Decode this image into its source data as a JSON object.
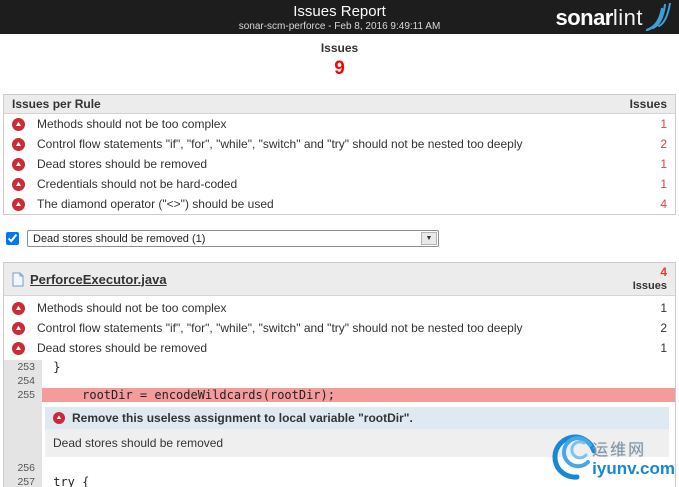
{
  "header": {
    "title": "Issues Report",
    "subtitle": "sonar-scm-perforce - Feb 8, 2016 9:49:11 AM",
    "logo_bold": "sonar",
    "logo_light": "lint"
  },
  "summary": {
    "label": "Issues",
    "count": "9"
  },
  "colors": {
    "banner_bg": "#1d1d1d",
    "accent_red": "#e4403c",
    "icon_red": "#cc2a36",
    "highlight_line": "#f49c9c",
    "issue_msg_bg": "#dfe9f1",
    "logo_arc_blue": "#3b9fd8"
  },
  "rules_table": {
    "header_left": "Issues per Rule",
    "header_right": "Issues",
    "rows": [
      {
        "label": "Methods should not be too complex",
        "count": "1"
      },
      {
        "label": "Control flow statements \"if\", \"for\", \"while\", \"switch\" and \"try\" should not be nested too deeply",
        "count": "2"
      },
      {
        "label": "Dead stores should be removed",
        "count": "1"
      },
      {
        "label": "Credentials should not be hard-coded",
        "count": "1"
      },
      {
        "label": "The diamond operator (\"<>\") should be used",
        "count": "4"
      }
    ]
  },
  "filter": {
    "checkbox_checked": true,
    "selected_option": "Dead stores should be removed (1)"
  },
  "file_section": {
    "filename": "PerforceExecutor.java",
    "issues_count": "4",
    "issues_label": "Issues",
    "rows": [
      {
        "label": "Methods should not be too complex",
        "count": "1"
      },
      {
        "label": "Control flow statements \"if\", \"for\", \"while\", \"switch\" and \"try\" should not be nested too deeply",
        "count": "2"
      },
      {
        "label": "Dead stores should be removed",
        "count": "1"
      }
    ],
    "code": {
      "lines": [
        {
          "num": "253",
          "text": " }"
        },
        {
          "num": "254",
          "text": ""
        },
        {
          "num": "255",
          "text": "     rootDir = encodeWildcards(rootDir);"
        }
      ],
      "issue_message": "Remove this useless assignment to local variable \"rootDir\".",
      "issue_rule": "Dead stores should be removed",
      "lines_after": [
        {
          "num": "256",
          "text": ""
        },
        {
          "num": "257",
          "text": " try {"
        }
      ]
    }
  },
  "watermark": {
    "cn": "运维网",
    "site": "iyunv.com"
  }
}
